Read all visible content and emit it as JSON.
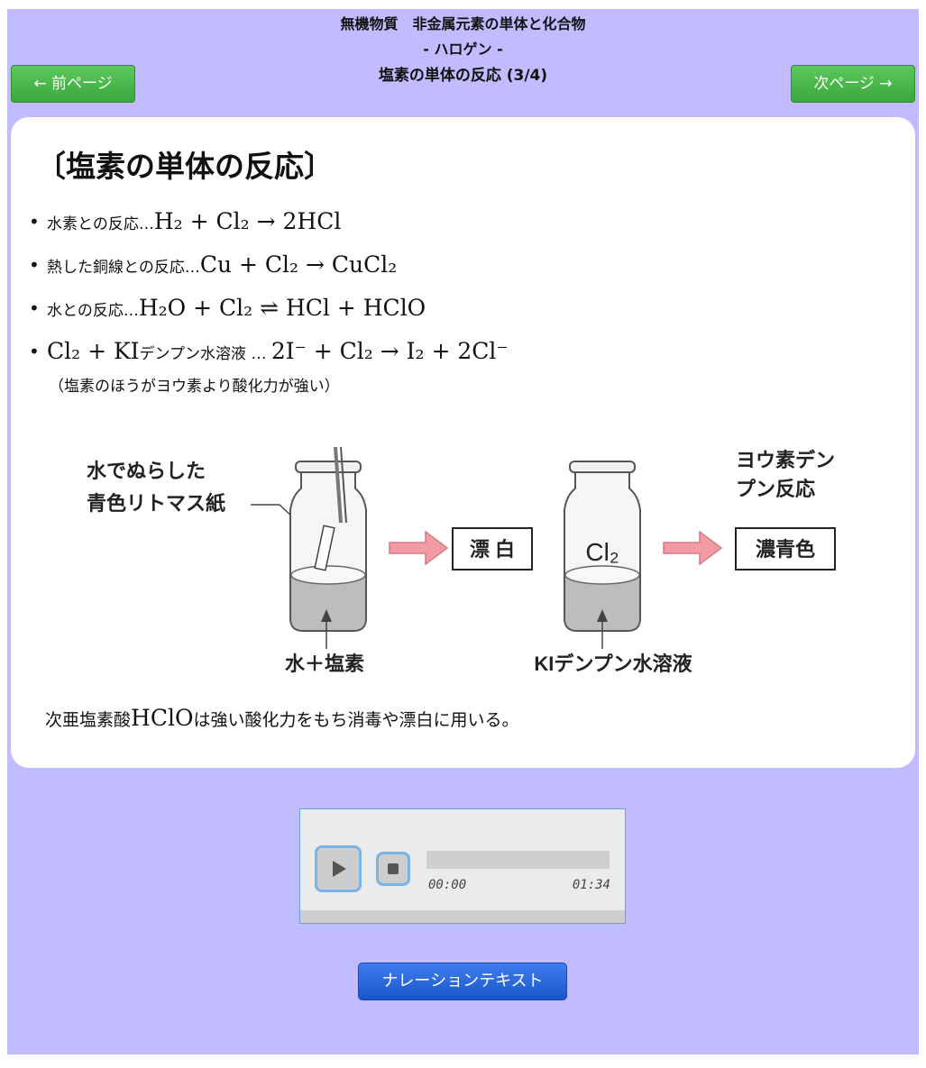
{
  "header": {
    "line1": "無機物質　非金属元素の単体と化合物",
    "line2": "- ハロゲン -",
    "line3": "塩素の単体の反応 (3/4)"
  },
  "nav": {
    "prev_label": "← 前ページ",
    "next_label": "次ページ →"
  },
  "card": {
    "title": "〔塩素の単体の反応〕",
    "reactions": [
      {
        "label": "水素との反応…",
        "equation": "H₂ + Cl₂ → 2HCl"
      },
      {
        "label": "熱した銅線との反応…",
        "equation": "Cu + Cl₂ → CuCl₂"
      },
      {
        "label": "水との反応…",
        "equation": "H₂O + Cl₂ ⇌ HCl + HClO"
      },
      {
        "pre": "Cl₂ + KI",
        "label": "デンプン水溶液 … ",
        "equation": "2I⁻ + Cl₂ → I₂ + 2Cl⁻"
      }
    ],
    "note": "（塩素のほうがヨウ素より酸化力が強い）",
    "diagram": {
      "litmus_label_1": "水でぬらした",
      "litmus_label_2": "青色リトマス紙",
      "result_1": "漂 白",
      "bottle_2_label": "Cl₂",
      "reaction_2_label_1": "ヨウ素デン",
      "reaction_2_label_2": "プン反応",
      "result_2": "濃青色",
      "bottle_1_bottom": "水＋塩素",
      "bottle_2_bottom": "KIデンプン水溶液"
    },
    "footer_pre": "次亜塩素酸",
    "footer_formula": "HClO",
    "footer_post": "は強い酸化力をもち消毒や漂白に用いる。"
  },
  "player": {
    "current_time": "00:00",
    "total_time": "01:34",
    "progress": 0
  },
  "narration_button": "ナレーションテキスト"
}
